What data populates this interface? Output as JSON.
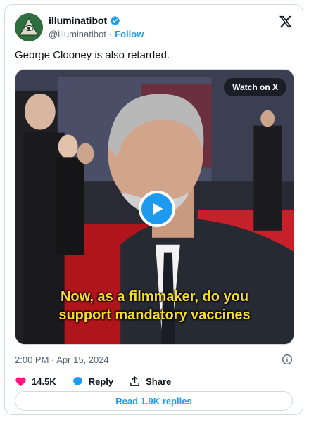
{
  "author": {
    "display_name": "illuminatibot",
    "handle": "@illuminatibot",
    "follow_label": "Follow",
    "separator": "·",
    "verified": true,
    "avatar_icon": "illuminati-eye-pyramid-icon"
  },
  "tweet": {
    "text": "George Clooney is also retarded."
  },
  "media": {
    "watch_label": "Watch on X",
    "caption_line1": "Now, as a filmmaker, do you",
    "caption_line2": "support mandatory vaccines",
    "play_icon": "play-icon"
  },
  "meta": {
    "timestamp": "2:00 PM · Apr 15, 2024"
  },
  "actions": {
    "likes": "14.5K",
    "reply_label": "Reply",
    "share_label": "Share"
  },
  "footer": {
    "read_replies_label": "Read 1.9K replies"
  },
  "colors": {
    "accent": "#1d9bf0",
    "like": "#f91880",
    "caption": "#f5dc2a",
    "muted": "#536471"
  }
}
